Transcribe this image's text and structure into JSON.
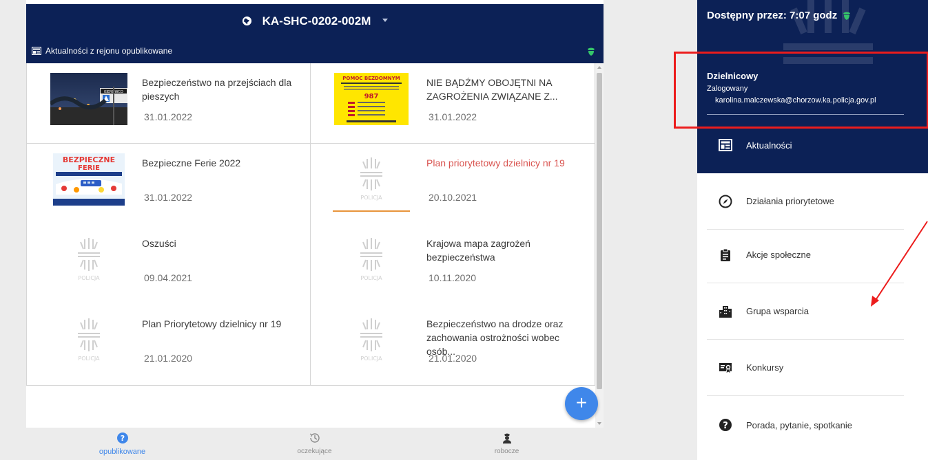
{
  "header": {
    "device_id": "KA-SHC-0202-002M",
    "section_title": "Aktualności z rejonu opublikowane"
  },
  "news": [
    {
      "title": "Bezpieczeństwo na przejściach dla pieszych",
      "date": "31.01.2022",
      "thumb": "photo-night-street-sign"
    },
    {
      "title": "NIE BĄDŹMY OBOJĘTNI NA ZAGROŻENIA ZWIĄZANE Z...",
      "date": "31.01.2022",
      "thumb": "poster-pomoc-bezdomnym"
    },
    {
      "title": "Bezpieczne Ferie 2022",
      "date": "31.01.2022",
      "thumb": "poster-bezpieczne-ferie"
    },
    {
      "title": "Plan priorytetowy dzielnicy nr 19",
      "date": "20.10.2021",
      "thumb": "police-placeholder"
    },
    {
      "title": "Oszuści",
      "date": "09.04.2021",
      "thumb": "police-placeholder"
    },
    {
      "title": "Krajowa mapa zagrożeń bezpieczeństwa",
      "date": "10.11.2020",
      "thumb": "police-placeholder"
    },
    {
      "title": "Plan Priorytetowy dzielnicy nr 19",
      "date": "21.01.2020",
      "thumb": "police-placeholder"
    },
    {
      "title": "Bezpieczeństwo na drodze oraz zachowania ostrożności wobec osób...",
      "date": "21.01.2020",
      "thumb": "police-placeholder"
    }
  ],
  "thumb_text": {
    "police_word": "POLICJA",
    "poster1_head": "POMOC BEZDOMNYM",
    "poster1_number": "987",
    "poster2_head": "BEZPIECZNE",
    "poster2_sub": "FERIE",
    "photo_sign": "KIEROWCO"
  },
  "bottom_nav": [
    {
      "label": "opublikowane",
      "icon": "question-circle-icon",
      "active": true
    },
    {
      "label": "oczekujące",
      "icon": "clock-history-icon",
      "active": false
    },
    {
      "label": "robocze",
      "icon": "officer-icon",
      "active": false
    }
  ],
  "fab": {
    "label": "+"
  },
  "menu": {
    "availability": "Dostępny przez: 7:07 godz",
    "role": "Dzielnicowy",
    "status": "Zalogowany",
    "email": "karolina.malczewska@chorzow.ka.policja.gov.pl",
    "items": [
      {
        "label": "Aktualności",
        "icon": "newspaper-icon"
      },
      {
        "label": "Działania priorytetowe",
        "icon": "compass-icon"
      },
      {
        "label": "Akcje społeczne",
        "icon": "clipboard-icon"
      },
      {
        "label": "Grupa wsparcia",
        "icon": "buildings-icon"
      },
      {
        "label": "Konkursy",
        "icon": "certificate-icon"
      },
      {
        "label": "Porada, pytanie, spotkanie",
        "icon": "question-circle-icon"
      }
    ]
  },
  "colors": {
    "navy": "#0c2156",
    "accent_red": "#d9534f",
    "accent_orange": "#e8943a",
    "fab_blue": "#3f87ea",
    "shield_green": "#35c46a",
    "annotation_red": "#ec1c1c"
  }
}
